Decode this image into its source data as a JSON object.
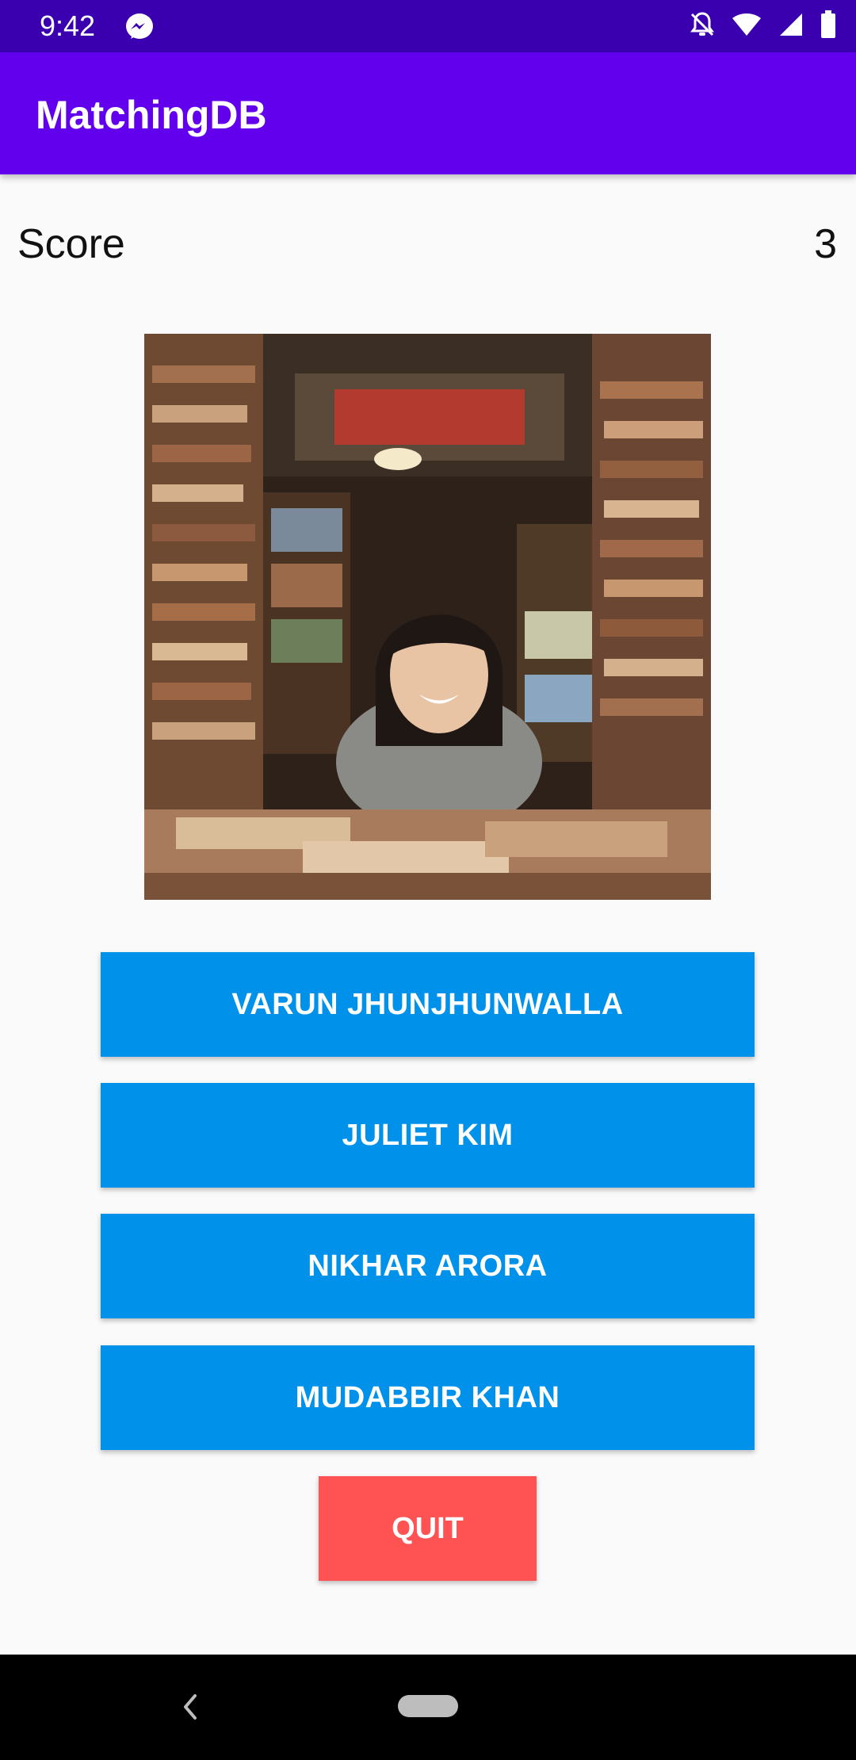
{
  "status_bar": {
    "time": "9:42",
    "icons": [
      "messenger-icon",
      "notifications-off-icon",
      "wifi-icon",
      "cellular-signal-icon",
      "battery-icon"
    ]
  },
  "app_bar": {
    "title": "MatchingDB"
  },
  "score": {
    "label": "Score",
    "value": "3"
  },
  "photo": {
    "subject": "smiling-person-in-bookstore-photo"
  },
  "choices": [
    {
      "label": "VARUN JHUNJHUNWALLA"
    },
    {
      "label": "JULIET KIM"
    },
    {
      "label": "NIKHAR ARORA"
    },
    {
      "label": "MUDABBIR KHAN"
    }
  ],
  "quit": {
    "label": "QUIT"
  },
  "navigation": {
    "icons": [
      "back-icon",
      "home-pill-icon"
    ]
  },
  "colors": {
    "status_bar": "#3A00B0",
    "app_bar": "#6200EE",
    "choice_button": "#0091EA",
    "quit_button": "#FF5252",
    "background": "#FAFAFA"
  }
}
